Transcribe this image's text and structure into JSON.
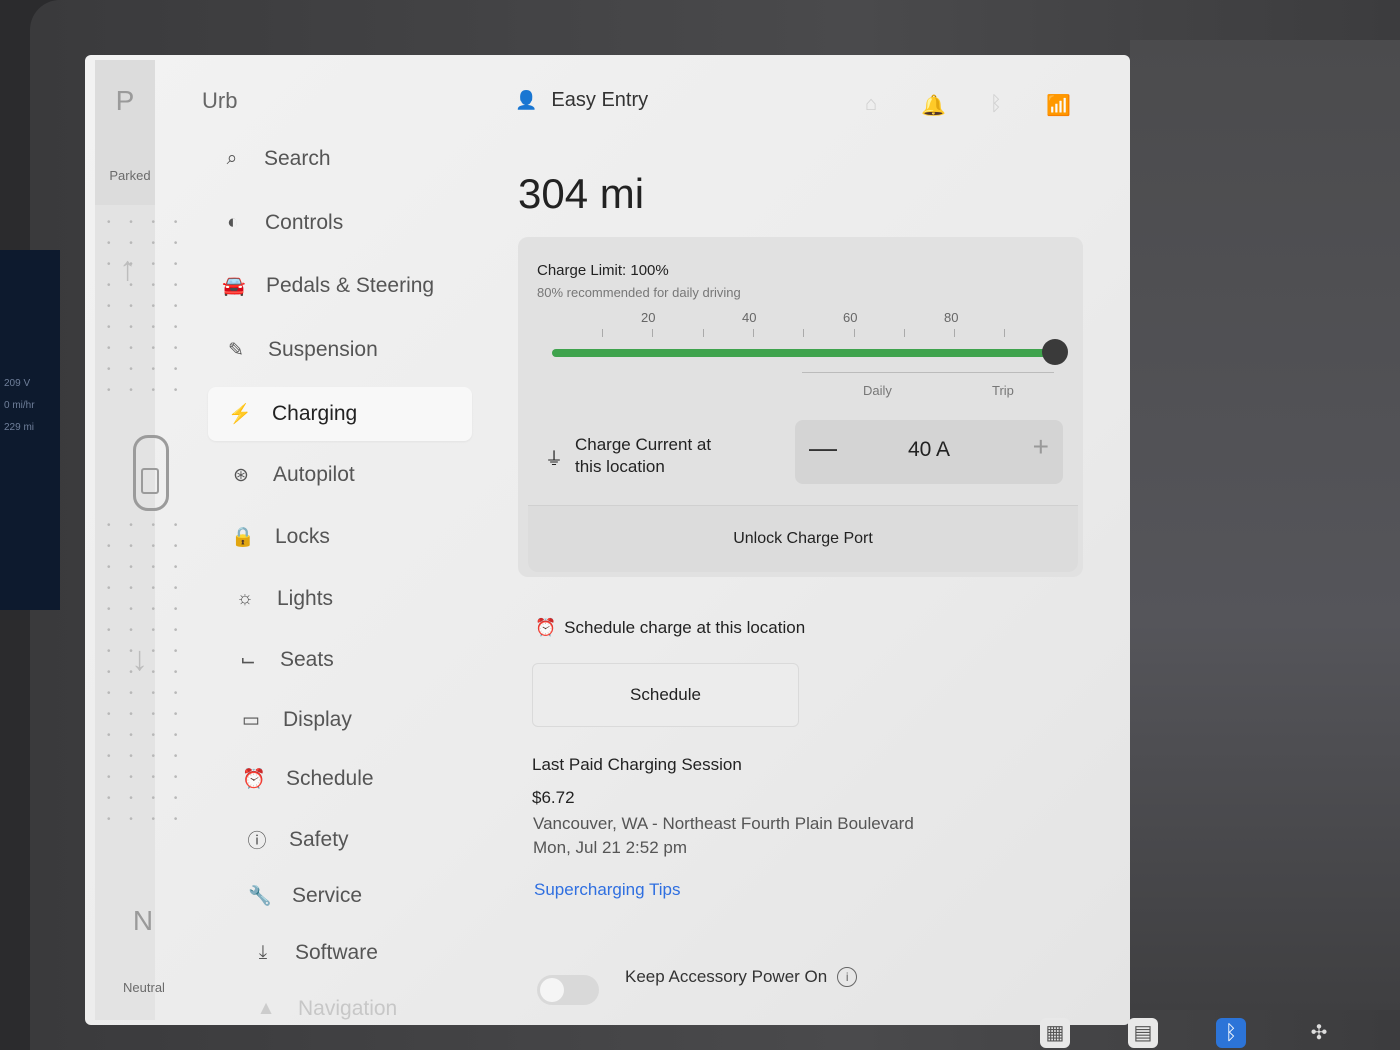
{
  "gear": {
    "top_letter": "P",
    "top_caption": "Parked",
    "bottom_letter": "N",
    "bottom_caption": "Neutral"
  },
  "header": {
    "car_name": "Urb",
    "profile_name": "Easy Entry"
  },
  "side_strip": [
    "209 V",
    "0 mi/hr",
    "229 mi"
  ],
  "nav": [
    {
      "label": "Search",
      "icon": "search-icon"
    },
    {
      "label": "Controls",
      "icon": "toggle-icon"
    },
    {
      "label": "Pedals & Steering",
      "icon": "car-icon"
    },
    {
      "label": "Suspension",
      "icon": "wrench-icon"
    },
    {
      "label": "Charging",
      "icon": "bolt-icon",
      "active": true
    },
    {
      "label": "Autopilot",
      "icon": "steering-wheel-icon"
    },
    {
      "label": "Locks",
      "icon": "lock-icon"
    },
    {
      "label": "Lights",
      "icon": "sun-icon"
    },
    {
      "label": "Seats",
      "icon": "seat-icon"
    },
    {
      "label": "Display",
      "icon": "display-icon"
    },
    {
      "label": "Schedule",
      "icon": "alarm-icon"
    },
    {
      "label": "Safety",
      "icon": "alert-icon"
    },
    {
      "label": "Service",
      "icon": "wrench-icon"
    },
    {
      "label": "Software",
      "icon": "download-icon"
    },
    {
      "label": "Navigation",
      "icon": "navigation-icon"
    }
  ],
  "charging": {
    "range": "304 mi",
    "limit_title": "Charge Limit: 100%",
    "limit_subtitle": "80% recommended for daily driving",
    "limit_percent": 100,
    "ticks": [
      "20",
      "40",
      "60",
      "80"
    ],
    "zone_daily": "Daily",
    "zone_trip": "Trip",
    "current_label_line1": "Charge Current at",
    "current_label_line2": "this location",
    "current_value": "40 A",
    "minus": "—",
    "plus": "+",
    "unlock_label": "Unlock Charge Port",
    "schedule_label": "Schedule charge at this location",
    "schedule_button": "Schedule",
    "last_session_title": "Last Paid Charging Session",
    "last_session_price": "$6.72",
    "last_session_location": "Vancouver, WA - Northeast Fourth Plain Boulevard",
    "last_session_time": "Mon, Jul 21 2:52 pm",
    "tips_link": "Supercharging Tips",
    "accessory_label": "Keep Accessory Power On",
    "accessory_on": false
  },
  "colors": {
    "accent_green": "#3fa34d",
    "link_blue": "#2f6fe0"
  }
}
